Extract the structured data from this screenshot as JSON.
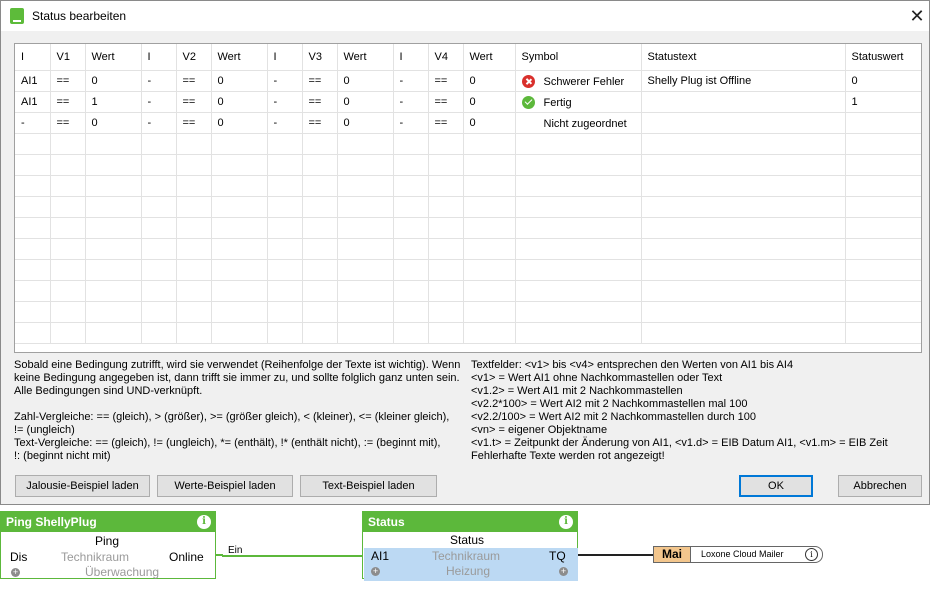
{
  "dialog": {
    "title": "Status bearbeiten",
    "close_glyph": "✕",
    "columns": [
      "I",
      "V1",
      "Wert",
      "I",
      "V2",
      "Wert",
      "I",
      "V3",
      "Wert",
      "I",
      "V4",
      "Wert",
      "Symbol",
      "Statustext",
      "Statuswert"
    ],
    "rows": [
      [
        "AI1",
        "==",
        "0",
        "-",
        "==",
        "0",
        "-",
        "==",
        "0",
        "-",
        "==",
        "0",
        "Schwerer Fehler",
        "Shelly Plug ist Offline",
        "0"
      ],
      [
        "AI1",
        "==",
        "1",
        "-",
        "==",
        "0",
        "-",
        "==",
        "0",
        "-",
        "==",
        "0",
        "Fertig",
        "",
        "1"
      ],
      [
        "-",
        "==",
        "0",
        "-",
        "==",
        "0",
        "-",
        "==",
        "0",
        "-",
        "==",
        "0",
        "Nicht zugeordnet",
        "",
        ""
      ]
    ],
    "row_icons": [
      "error-icon",
      "check-icon",
      ""
    ],
    "info_left": [
      "Sobald eine Bedingung zutrifft, wird sie verwendet (Reihenfolge der Texte ist wichtig). Wenn",
      "keine Bedingung angegeben ist, dann trifft sie immer zu, und sollte folglich ganz unten sein.",
      "Alle Bedingungen sind UND-verknüpft.",
      "",
      "Zahl-Vergleiche: == (gleich), > (größer), >= (größer gleich), < (kleiner), <= (kleiner gleich),",
      "!= (ungleich)",
      "Text-Vergleiche: == (gleich), != (ungleich), *= (enthält), !* (enthält nicht), := (beginnt mit),",
      "!: (beginnt nicht mit)"
    ],
    "info_right": [
      "Textfelder: <v1> bis <v4> entsprechen den Werten von AI1 bis AI4",
      "<v1> = Wert AI1 ohne Nachkommastellen oder Text",
      "<v1.2> = Wert AI1 mit 2 Nachkommastellen",
      "<v2.2*100> = Wert AI2 mit 2 Nachkommastellen mal 100",
      "<v2.2/100> = Wert AI2 mit 2 Nachkommastellen durch 100",
      "<vn> = eigener Objektname",
      "<v1.t> = Zeitpunkt der Änderung von AI1, <v1.d> = EIB Datum AI1, <v1.m> = EIB Zeit",
      "Fehlerhafte Texte werden rot angezeigt!"
    ],
    "buttons": {
      "jalousie": "Jalousie-Beispiel laden",
      "werte": "Werte-Beispiel laden",
      "text": "Text-Beispiel laden",
      "ok": "OK",
      "cancel": "Abbrechen"
    }
  },
  "ping_block": {
    "title": "Ping ShellyPlug",
    "name": "Ping",
    "input": "Dis",
    "room": "Technikraum",
    "output": "Online",
    "category": "Überwachung",
    "info_glyph": "i"
  },
  "wire_label": "Ein",
  "status_block": {
    "title": "Status",
    "name": "Status",
    "input": "AI1",
    "room": "Technikraum",
    "output": "TQ",
    "category": "Heizung",
    "info_glyph": "i"
  },
  "mailer": {
    "tab": "Mai",
    "label": "Loxone Cloud Mailer",
    "info_glyph": "i"
  },
  "colors": {
    "block_green": "#5cb83b",
    "error_red": "#d9302c",
    "selection_blue": "#bcd9f3",
    "mailer_orange": "#f3c68d"
  }
}
